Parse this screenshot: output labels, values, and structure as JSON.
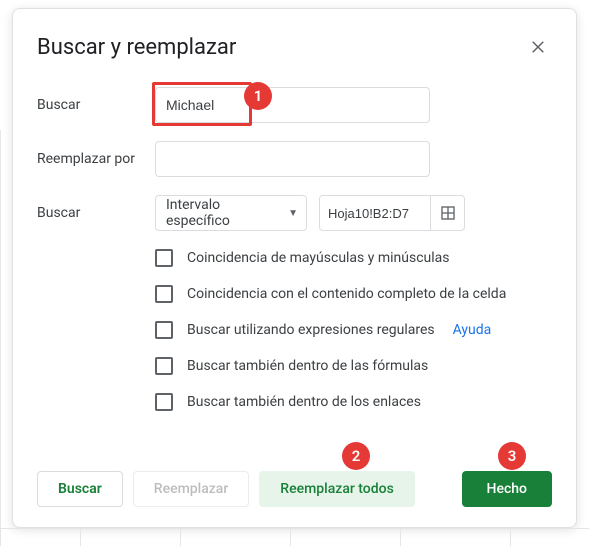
{
  "dialog": {
    "title": "Buscar y reemplazar",
    "labels": {
      "search": "Buscar",
      "replace": "Reemplazar por",
      "scope": "Buscar"
    },
    "search_value": "Michael",
    "replace_value": "",
    "scope_dropdown": {
      "selected": "Intervalo específico"
    },
    "range": "Hoja10!B2:D7",
    "options": {
      "match_case": "Coincidencia de mayúsculas y minúsculas",
      "entire_cell": "Coincidencia con el contenido completo de la celda",
      "regex": "Buscar utilizando expresiones regulares",
      "regex_help": "Ayuda",
      "formulas": "Buscar también dentro de las fórmulas",
      "links": "Buscar también dentro de los enlaces"
    },
    "buttons": {
      "search": "Buscar",
      "replace": "Reemplazar",
      "replace_all": "Reemplazar todos",
      "done": "Hecho"
    }
  },
  "annotations": {
    "badge1": "1",
    "badge2": "2",
    "badge3": "3"
  }
}
